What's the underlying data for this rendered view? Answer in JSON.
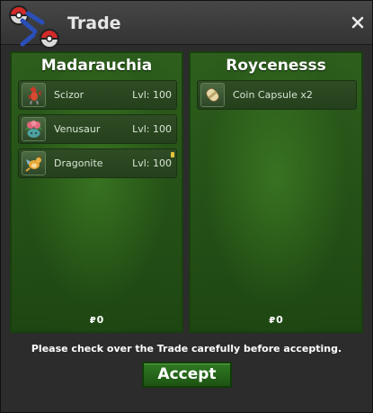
{
  "window": {
    "title": "Trade"
  },
  "left_panel": {
    "player": "Madarauchia",
    "items": [
      {
        "name": "Scizor",
        "level": "Lvl: 100",
        "icon": "scizor-icon"
      },
      {
        "name": "Venusaur",
        "level": "Lvl: 100",
        "icon": "venusaur-icon"
      },
      {
        "name": "Dragonite",
        "level": "Lvl: 100",
        "icon": "dragonite-icon"
      }
    ],
    "money": "0"
  },
  "right_panel": {
    "player": "Roycenesss",
    "items": [
      {
        "name": "Coin Capsule  x2",
        "icon": "coin-capsule-icon"
      }
    ],
    "money": "0"
  },
  "notice": "Please check over the Trade carefully before accepting.",
  "accept_label": "Accept",
  "currency_symbol": "₽"
}
